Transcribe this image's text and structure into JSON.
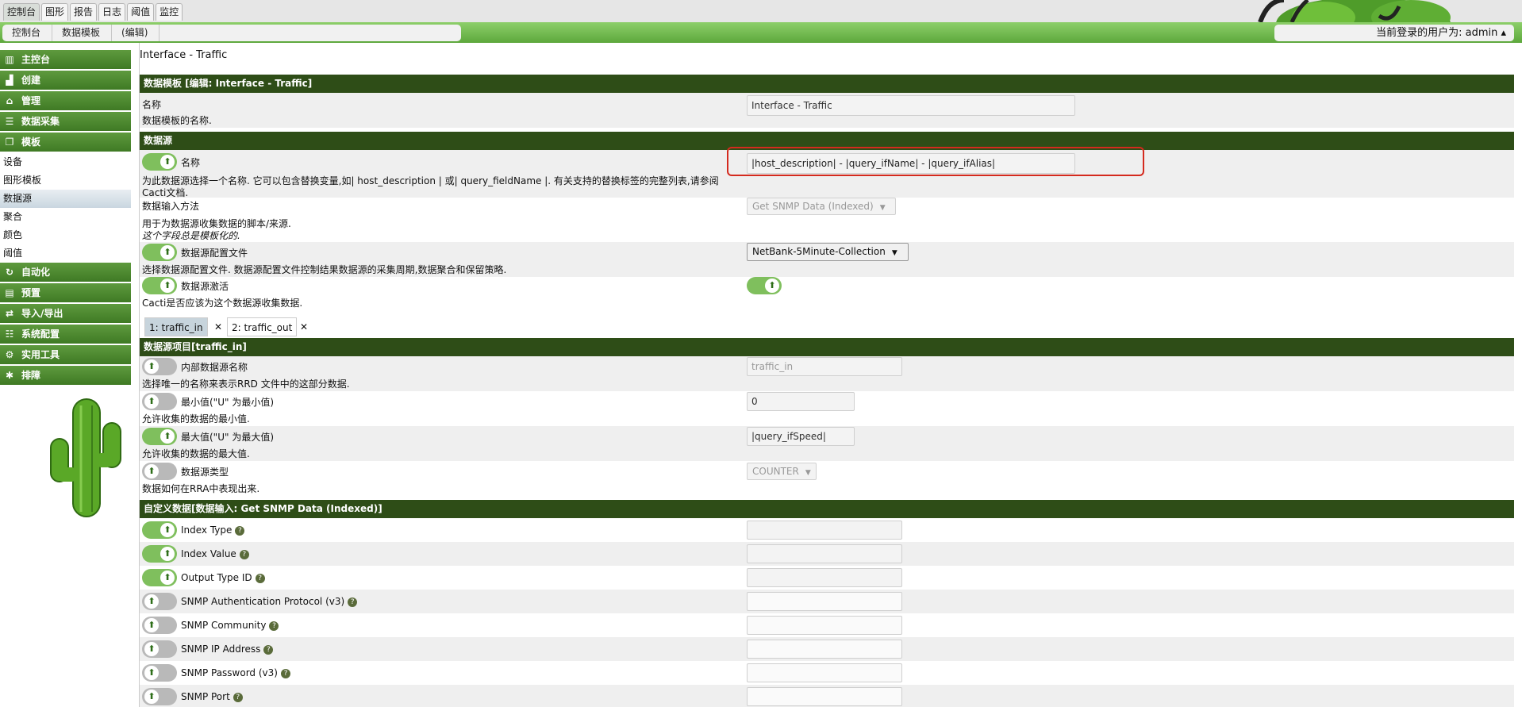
{
  "topbar": {
    "tabs": [
      "控制台",
      "图形",
      "报告",
      "日志",
      "阈值",
      "监控"
    ]
  },
  "breadcrumb": [
    "控制台",
    "数据模板",
    "(编辑)"
  ],
  "user": {
    "text": "当前登录的用户为: admin ▴"
  },
  "sidebar": {
    "items": [
      {
        "label": "主控台",
        "icon": "map-icon"
      },
      {
        "label": "创建",
        "icon": "chart-icon"
      },
      {
        "label": "管理",
        "icon": "home-icon"
      },
      {
        "label": "数据采集",
        "icon": "database-icon"
      },
      {
        "label": "模板",
        "icon": "copy-icon"
      }
    ],
    "sub": [
      "设备",
      "图形模板",
      "数据源",
      "聚合",
      "颜色",
      "阈值"
    ],
    "items2": [
      {
        "label": "自动化",
        "icon": "refresh-icon"
      },
      {
        "label": "预置",
        "icon": "archive-icon"
      },
      {
        "label": "导入/导出",
        "icon": "exchange-icon"
      },
      {
        "label": "系统配置",
        "icon": "sliders-icon"
      },
      {
        "label": "实用工具",
        "icon": "cogs-icon"
      },
      {
        "label": "排障",
        "icon": "bug-icon"
      }
    ]
  },
  "page": {
    "title": "Interface - Traffic"
  },
  "sec1": {
    "title": "数据模板 [编辑: Interface - Traffic]",
    "name_label": "名称",
    "name_value": "Interface - Traffic",
    "name_desc": "数据模板的名称."
  },
  "sec2": {
    "title": "数据源",
    "ds_name_label": "名称",
    "ds_name_value": "|host_description| -  |query_ifName| - |query_ifAlias|",
    "ds_name_desc1": "为此数据源选择一个名称. 它可以包含替换变量,如| host_description | 或| query_fieldName |. 有关支持的替换标签的完整列表,请参阅",
    "ds_name_desc2": "Cacti文档.",
    "input_label": "数据输入方法",
    "input_value": "Get SNMP Data (Indexed)",
    "input_desc": "用于为数据源收集数据的脚本/来源.",
    "input_note": "这个字段总是模板化的.",
    "profile_label": "数据源配置文件",
    "profile_value": "NetBank-5Minute-Collection",
    "profile_desc": "选择数据源配置文件. 数据源配置文件控制结果数据源的采集周期,数据聚合和保留策略.",
    "active_label": "数据源激活",
    "active_desc": "Cacti是否应该为这个数据源收集数据."
  },
  "tabs": [
    "1: traffic_in",
    "2: traffic_out"
  ],
  "sec3": {
    "title": "数据源项目[traffic_in]",
    "internal_label": "内部数据源名称",
    "internal_value": "traffic_in",
    "internal_desc": "选择唯一的名称来表示RRD 文件中的这部分数据.",
    "min_label": "最小值(\"U\" 为最小值)",
    "min_value": "0",
    "min_desc": "允许收集的数据的最小值.",
    "max_label": "最大值(\"U\" 为最大值)",
    "max_value": "|query_ifSpeed|",
    "max_desc": "允许收集的数据的最大值.",
    "type_label": "数据源类型",
    "type_value": "COUNTER",
    "type_desc": "数据如何在RRA中表现出来."
  },
  "sec4": {
    "title": "自定义数据[数据输入: Get SNMP Data (Indexed)]",
    "fields": [
      "Index Type",
      "Index Value",
      "Output Type ID",
      "SNMP Authentication Protocol (v3)",
      "SNMP Community",
      "SNMP IP Address",
      "SNMP Password (v3)",
      "SNMP Port"
    ]
  }
}
